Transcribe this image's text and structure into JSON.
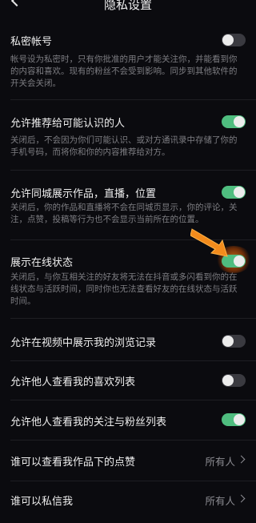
{
  "header": {
    "title": "隐私设置"
  },
  "items": [
    {
      "title": "私密帐号",
      "desc": "帐号设为私密时，只有你批准的用户才能关注你，并能看到你的内容和喜欢。现有的粉丝不会受到影响。同步到其他软件的开关会关闭。",
      "toggle": "off"
    },
    {
      "title": "允许推荐给可能认识的人",
      "desc": "关闭后，不会因为你们可能认识、或对方通讯录中存储了你的手机号码，而将你和你的内容推荐给对方。",
      "toggle": "on"
    },
    {
      "title": "允许同城展示作品，直播，位置",
      "desc": "关闭后，你的作品和直播将不会在同城页显示，你的评论，关注，点赞，投稿等行为也不会显示当前所在的位置。",
      "toggle": "on"
    },
    {
      "title": "展示在线状态",
      "desc": "关闭后，与你互相关注的好友将无法在抖音或多闪看到你的在线状态与活跃时间，同时你也无法查看好友的在线状态与活跃时间。",
      "toggle": "on"
    },
    {
      "title": "允许在视频中展示我的浏览记录",
      "toggle": "off"
    },
    {
      "title": "允许他人查看我的喜欢列表",
      "toggle": "off"
    },
    {
      "title": "允许他人查看我的关注与粉丝列表",
      "toggle": "on"
    },
    {
      "title": "谁可以查看我作品下的点赞",
      "value": "所有人"
    },
    {
      "title": "谁可以私信我",
      "value": "所有人"
    }
  ]
}
